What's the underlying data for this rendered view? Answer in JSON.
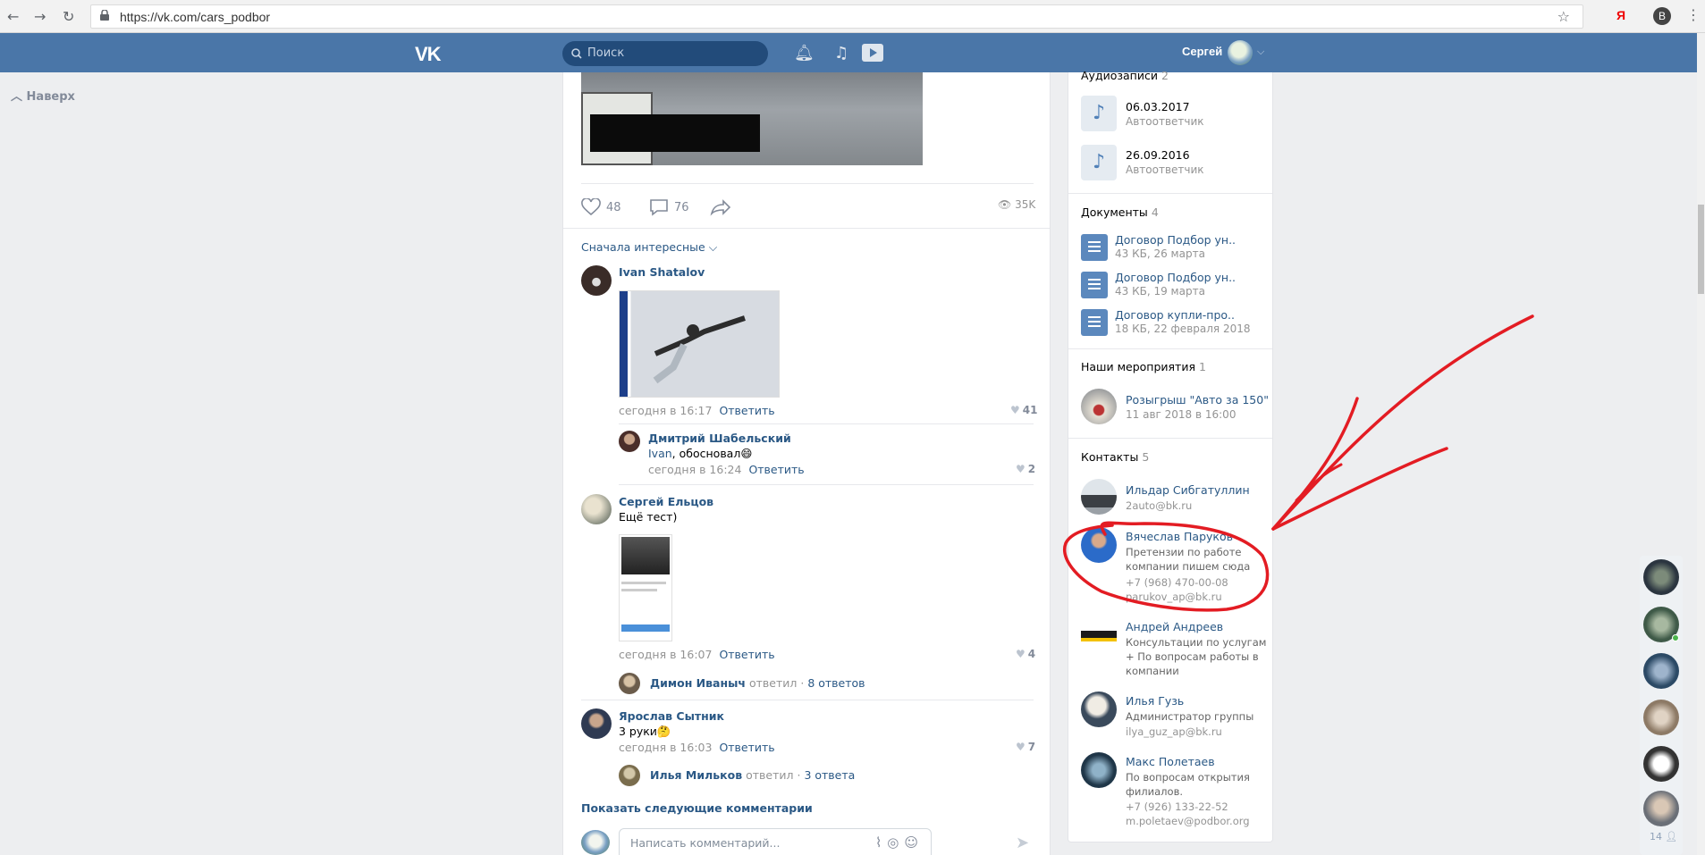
{
  "browser": {
    "url": "https://vk.com/cars_podbor",
    "ext_ya": "Я",
    "profile_initial": "В"
  },
  "header": {
    "logo": "VK",
    "search_placeholder": "Поиск",
    "user_name": "Сергей"
  },
  "nav": {
    "up_label": "Наверх"
  },
  "post": {
    "likes": "48",
    "comments": "76",
    "views": "35K",
    "sort_label": "Сначала интересные"
  },
  "comments": [
    {
      "author": "Ivan Shatalov",
      "text": "",
      "time": "сегодня в 16:17",
      "reply": "Ответить",
      "likes": "41"
    },
    {
      "author": "Дмитрий Шабельский",
      "mention": "Ivan",
      "text": ", обосновал😄",
      "time": "сегодня в 16:24",
      "reply": "Ответить",
      "likes": "2"
    },
    {
      "author": "Сергей Ельцов",
      "text": "Ещё тест)",
      "time": "сегодня в 16:07",
      "reply": "Ответить",
      "likes": "4",
      "thread": {
        "who": "Димон Иваныч",
        "verb": "ответил",
        "count": "8 ответов"
      }
    },
    {
      "author": "Ярослав Сытник",
      "text": "3 руки🤔",
      "time": "сегодня в 16:03",
      "reply": "Ответить",
      "likes": "7",
      "thread": {
        "who": "Илья Мильков",
        "verb": "ответил",
        "count": "3 ответа"
      }
    }
  ],
  "more_comments": "Показать следующие комментарии",
  "compose_placeholder": "Написать комментарий...",
  "sidebar": {
    "audio": {
      "title": "Аудиозаписи",
      "count": "2",
      "items": [
        {
          "title": "06.03.2017",
          "sub": "Автоответчик"
        },
        {
          "title": "26.09.2016",
          "sub": "Автоответчик"
        }
      ]
    },
    "docs": {
      "title": "Документы",
      "count": "4",
      "items": [
        {
          "title": "Договор Подбор ун..",
          "sub": "43 КБ, 26 марта"
        },
        {
          "title": "Договор Подбор ун..",
          "sub": "43 КБ, 19 марта"
        },
        {
          "title": "Договор купли-про..",
          "sub": "18 КБ, 22 февраля 2018"
        }
      ]
    },
    "events": {
      "title": "Наши мероприятия",
      "count": "1",
      "items": [
        {
          "title": "Розыгрыш \"Авто за 150\"",
          "sub": "11 авг 2018 в 16:00"
        }
      ]
    },
    "contacts": {
      "title": "Контакты",
      "count": "5",
      "items": [
        {
          "name": "Ильдар Сибгатуллин",
          "lines": [],
          "gray": [
            "2auto@bk.ru"
          ]
        },
        {
          "name": "Вячеслав Паруков",
          "lines": [
            "Претензии по работе",
            "компании пишем сюда"
          ],
          "gray": [
            "+7 (968) 470-00-08",
            "parukov_ap@bk.ru"
          ]
        },
        {
          "name": "Андрей Андреев",
          "lines": [
            "Консультации по услугам",
            "+ По вопросам работы в",
            "компании"
          ],
          "gray": []
        },
        {
          "name": "Илья Гузь",
          "lines": [
            "Администратор группы"
          ],
          "gray": [
            "ilya_guz_ap@bk.ru"
          ]
        },
        {
          "name": "Макс Полетаев",
          "lines": [
            "По вопросам открытия",
            "филиалов."
          ],
          "gray": [
            "+7 (926) 133-22-52",
            "m.poletaev@podbor.org"
          ]
        }
      ]
    }
  },
  "chat_rail": {
    "count": "14"
  },
  "colors": {
    "vk_blue": "#4a76a8",
    "link": "#2a5885",
    "annotation_red": "#e31c23"
  }
}
